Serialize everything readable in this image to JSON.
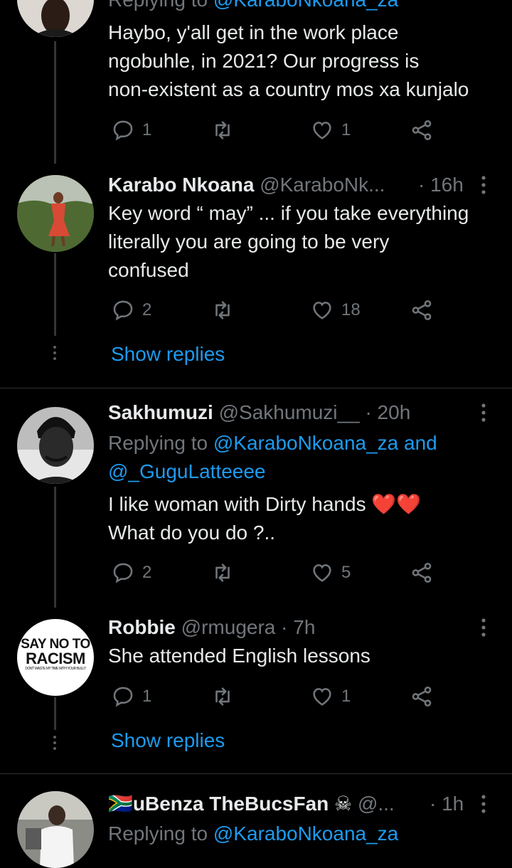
{
  "tweets": [
    {
      "reply_prefix": "Replying to",
      "reply_to": "@KaraboNkoana_za",
      "text_lines": [
        "Haybo, y'all get in the work place",
        "ngobuhle, in 2021? Our progress is",
        "non-existent as a country mos xa kunjalo"
      ],
      "replies": "1",
      "retweets": "",
      "likes": "1"
    },
    {
      "name": "Karabo Nkoana",
      "handle": "@KaraboNk...",
      "time": "· 16h",
      "text_lines": [
        "Key word “ may” ... if you take everything",
        "literally you are going to be very",
        "confused"
      ],
      "replies": "2",
      "retweets": "",
      "likes": "18",
      "show_replies": "Show replies"
    },
    {
      "name": "Sakhumuzi",
      "handle": "@Sakhumuzi__",
      "time": "· 20h",
      "reply_prefix": "Replying to",
      "reply_to": "@KaraboNkoana_za",
      "reply_and": "and",
      "reply_to2": "@_GuguLatteeee",
      "text_lines": [
        "I like woman with Dirty hands",
        "What do you do ?.."
      ],
      "emoji": "❤️❤️",
      "replies": "2",
      "retweets": "",
      "likes": "5"
    },
    {
      "name": "Robbie",
      "handle": "@rmugera",
      "time": "· 7h",
      "avatar_text": [
        "SAY NO TO",
        "RACISM",
        "DON'T WASTE MY TIME WITH YOUR BULLY"
      ],
      "text_lines": [
        "She attended English lessons"
      ],
      "replies": "1",
      "retweets": "",
      "likes": "1",
      "show_replies": "Show replies"
    },
    {
      "flag": "🇿🇦",
      "name": "uBenza TheBucsFan",
      "skull": "☠",
      "handle": "@...",
      "time": "· 1h",
      "reply_prefix": "Replying to",
      "reply_to": "@KaraboNkoana_za"
    }
  ],
  "colors": {
    "background": "#000000",
    "text": "#e7e9ea",
    "muted": "#71767b",
    "link": "#1d9bf0",
    "divider": "#2f3336"
  },
  "icons": {
    "reply": "reply-icon",
    "retweet": "retweet-icon",
    "like": "heart-icon",
    "share": "share-icon",
    "more": "more-vertical-icon"
  }
}
